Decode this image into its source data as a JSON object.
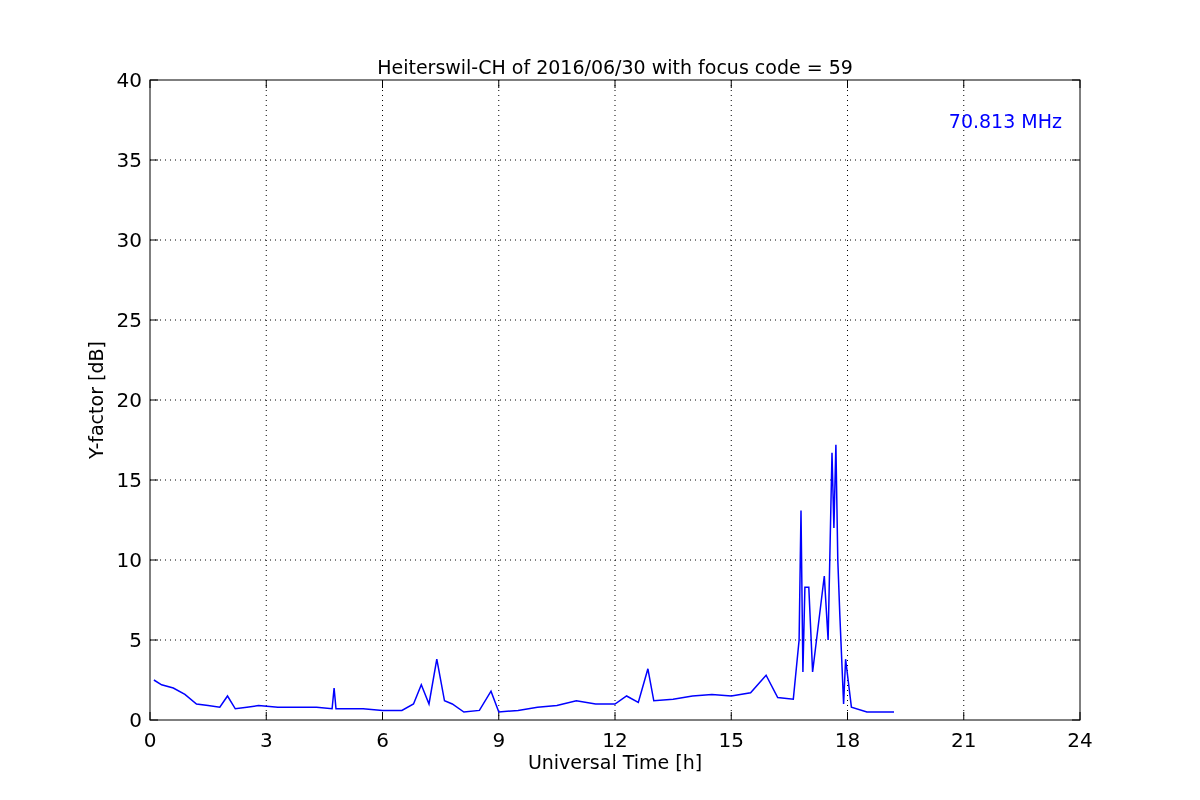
{
  "chart_data": {
    "type": "line",
    "title": "Heiterswil-CH of 2016/06/30 with focus code = 59",
    "xlabel": "Universal Time [h]",
    "ylabel": "Y-factor [dB]",
    "x": [
      0.1,
      0.3,
      0.6,
      0.9,
      1.2,
      1.5,
      1.8,
      2.0,
      2.2,
      2.5,
      2.8,
      3.3,
      3.8,
      4.3,
      4.7,
      4.75,
      4.8,
      5.5,
      6.0,
      6.5,
      6.8,
      7.0,
      7.2,
      7.4,
      7.6,
      7.8,
      8.1,
      8.5,
      8.8,
      9.0,
      9.5,
      10.0,
      10.5,
      11.0,
      11.5,
      12.0,
      12.3,
      12.6,
      12.85,
      13.0,
      13.5,
      14.0,
      14.5,
      15.0,
      15.5,
      15.9,
      16.2,
      16.6,
      16.75,
      16.8,
      16.85,
      16.9,
      17.0,
      17.1,
      17.4,
      17.5,
      17.6,
      17.65,
      17.7,
      17.75,
      17.8,
      17.9,
      17.95,
      18.1,
      18.5,
      19.0,
      19.2
    ],
    "series": [
      {
        "name": "70.813 MHz",
        "color": "#0000ff",
        "values": [
          2.5,
          2.2,
          2.0,
          1.6,
          1.0,
          0.9,
          0.8,
          1.5,
          0.7,
          0.8,
          0.9,
          0.8,
          0.8,
          0.8,
          0.7,
          2.0,
          0.7,
          0.7,
          0.6,
          0.6,
          1.0,
          2.2,
          1.0,
          3.8,
          1.2,
          1.0,
          0.5,
          0.6,
          1.8,
          0.5,
          0.6,
          0.8,
          0.9,
          1.2,
          1.0,
          1.0,
          1.5,
          1.1,
          3.2,
          1.2,
          1.3,
          1.5,
          1.6,
          1.5,
          1.7,
          2.8,
          1.4,
          1.3,
          5.0,
          13.1,
          3.0,
          8.3,
          8.3,
          3.0,
          9.0,
          5.0,
          16.7,
          12.0,
          17.2,
          10.0,
          6.6,
          1.0,
          3.8,
          0.8,
          0.5,
          0.5,
          0.5
        ]
      }
    ],
    "xlim": [
      0,
      24
    ],
    "ylim": [
      0,
      40
    ],
    "xticks": [
      0,
      3,
      6,
      9,
      12,
      15,
      18,
      21,
      24
    ],
    "yticks": [
      0,
      5,
      10,
      15,
      20,
      25,
      30,
      35,
      40
    ],
    "grid": true
  }
}
